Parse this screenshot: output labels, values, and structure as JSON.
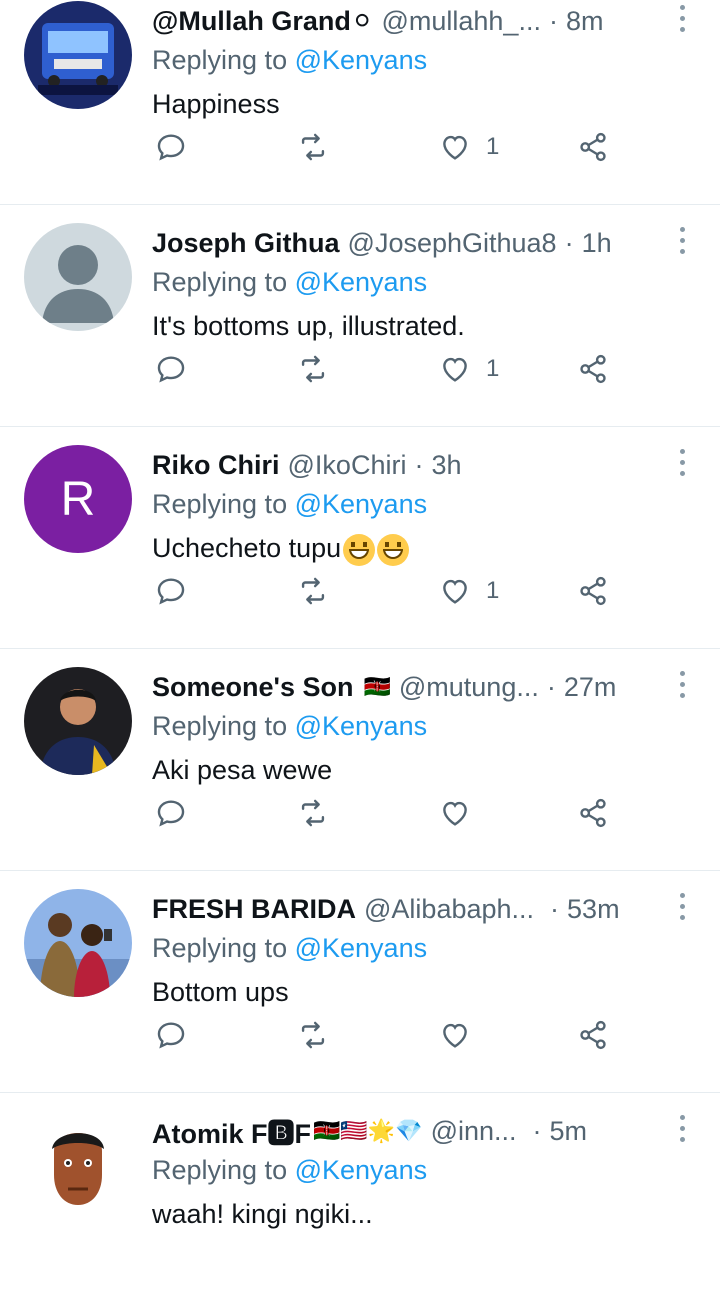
{
  "tweets": [
    {
      "name": "@Mullah Grand⚪",
      "handle": "@mullahh_...",
      "time": "8m",
      "replying_prefix": "Replying to",
      "mention": "@Kenyans",
      "text": "Happiness",
      "likes": "1"
    },
    {
      "name": "Joseph Githua",
      "handle": "@JosephGithua8",
      "time": "1h",
      "replying_prefix": "Replying to",
      "mention": "@Kenyans",
      "text": "It's bottoms up, illustrated.",
      "likes": "1"
    },
    {
      "name": "Riko Chiri",
      "handle": "@IkoChiri",
      "time": "3h",
      "replying_prefix": "Replying to",
      "mention": "@Kenyans",
      "text": "Uchecheto tupu",
      "likes": "1",
      "avatar_letter": "R"
    },
    {
      "name": "Someone's Son",
      "name_emoji": "🇰🇪",
      "handle": "@mutung...",
      "time": "27m",
      "replying_prefix": "Replying to",
      "mention": "@Kenyans",
      "text": "Aki pesa wewe",
      "likes": ""
    },
    {
      "name": "FRESH BARIDA",
      "handle": "@Alibabaph...",
      "time": "53m",
      "replying_prefix": "Replying to",
      "mention": "@Kenyans",
      "text": "Bottom ups",
      "likes": ""
    },
    {
      "name": "Atomik F🅱F",
      "name_emoji": "🇰🇪🇱🇷🌟💎",
      "handle": "@inn...",
      "time": "5m",
      "replying_prefix": "Replying to",
      "mention": "@Kenyans",
      "text": "waah! kingi ngiki...",
      "likes": ""
    }
  ],
  "colors": {
    "mention": "#1d9bf0",
    "meta": "#536471",
    "divider": "#e6ecf0",
    "avatar_purple": "#7b1fa2"
  },
  "icons": [
    "reply-icon",
    "retweet-icon",
    "like-icon",
    "share-icon",
    "more-icon"
  ]
}
